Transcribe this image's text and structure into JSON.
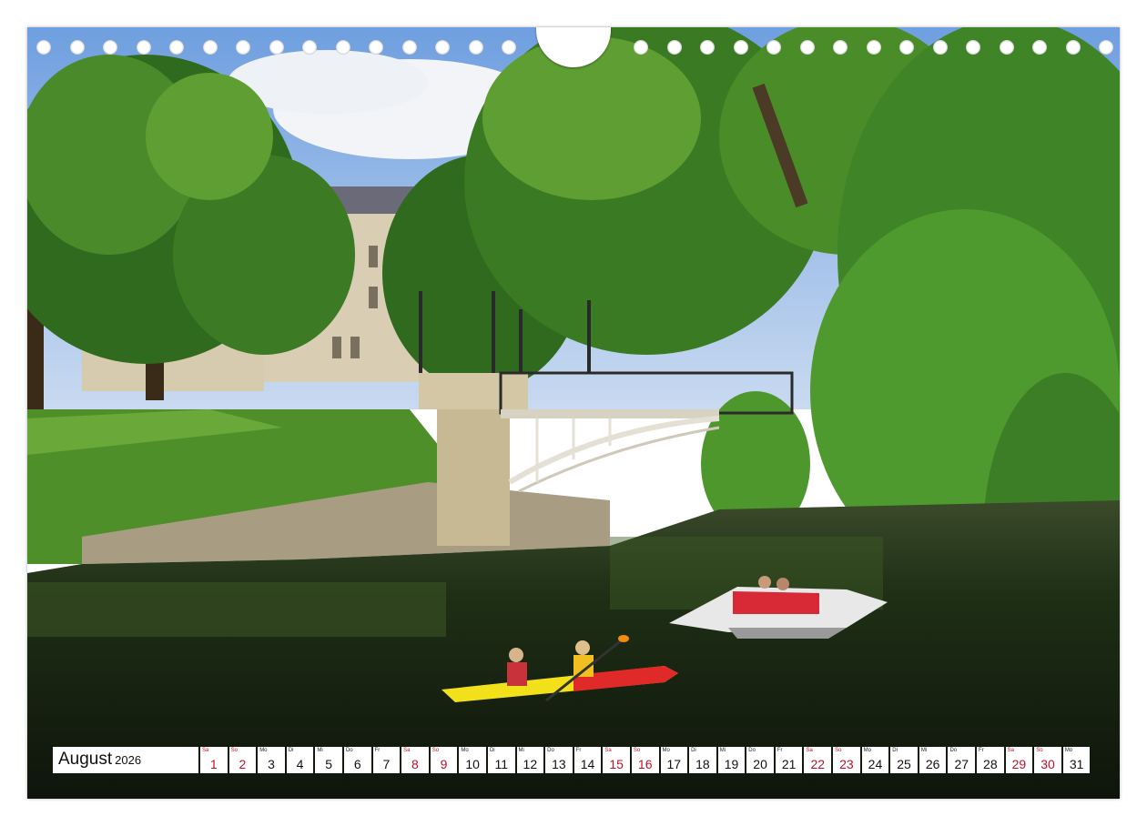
{
  "calendar": {
    "month": "August",
    "year": "2026",
    "weekend_color": "#c0112b",
    "days": [
      {
        "wd": "Sa",
        "d": "1",
        "we": true
      },
      {
        "wd": "So",
        "d": "2",
        "we": true
      },
      {
        "wd": "Mo",
        "d": "3",
        "we": false
      },
      {
        "wd": "Di",
        "d": "4",
        "we": false
      },
      {
        "wd": "Mi",
        "d": "5",
        "we": false
      },
      {
        "wd": "Do",
        "d": "6",
        "we": false
      },
      {
        "wd": "Fr",
        "d": "7",
        "we": false
      },
      {
        "wd": "Sa",
        "d": "8",
        "we": true
      },
      {
        "wd": "So",
        "d": "9",
        "we": true
      },
      {
        "wd": "Mo",
        "d": "10",
        "we": false
      },
      {
        "wd": "Di",
        "d": "11",
        "we": false
      },
      {
        "wd": "Mi",
        "d": "12",
        "we": false
      },
      {
        "wd": "Do",
        "d": "13",
        "we": false
      },
      {
        "wd": "Fr",
        "d": "14",
        "we": false
      },
      {
        "wd": "Sa",
        "d": "15",
        "we": true
      },
      {
        "wd": "So",
        "d": "16",
        "we": true
      },
      {
        "wd": "Mo",
        "d": "17",
        "we": false
      },
      {
        "wd": "Di",
        "d": "18",
        "we": false
      },
      {
        "wd": "Mi",
        "d": "19",
        "we": false
      },
      {
        "wd": "Do",
        "d": "20",
        "we": false
      },
      {
        "wd": "Fr",
        "d": "21",
        "we": false
      },
      {
        "wd": "Sa",
        "d": "22",
        "we": true
      },
      {
        "wd": "So",
        "d": "23",
        "we": true
      },
      {
        "wd": "Mo",
        "d": "24",
        "we": false
      },
      {
        "wd": "Di",
        "d": "25",
        "we": false
      },
      {
        "wd": "Mi",
        "d": "26",
        "we": false
      },
      {
        "wd": "Do",
        "d": "27",
        "we": false
      },
      {
        "wd": "Fr",
        "d": "28",
        "we": false
      },
      {
        "wd": "Sa",
        "d": "29",
        "we": true
      },
      {
        "wd": "So",
        "d": "30",
        "we": true
      },
      {
        "wd": "Mo",
        "d": "31",
        "we": false
      }
    ]
  },
  "binding": {
    "hole_count": 32
  },
  "photo": {
    "colors": {
      "sky": "#8fb8e8",
      "foliage_dark": "#2f6a1e",
      "foliage_light": "#5f9e32",
      "water": "#1d2a18",
      "kayak": "#f2e01a",
      "kayak_stern": "#e02a2a",
      "stone": "#b9ad8f"
    }
  }
}
